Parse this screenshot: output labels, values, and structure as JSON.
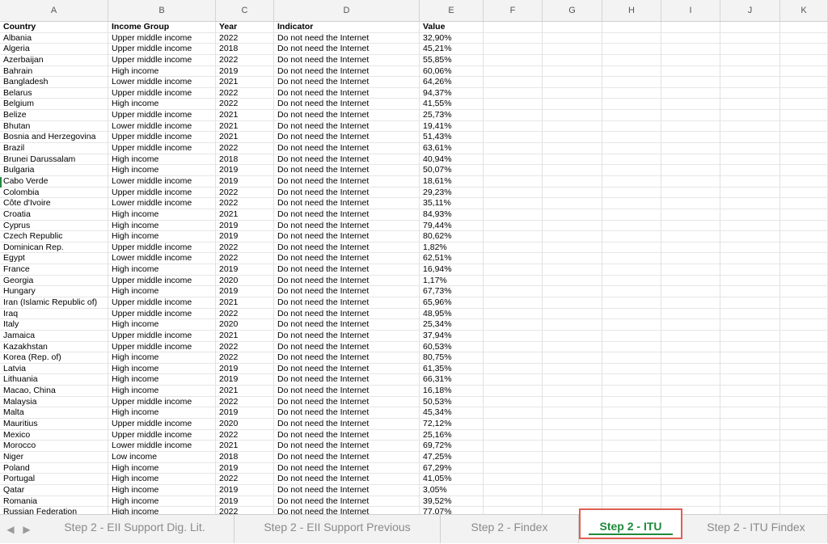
{
  "columns": [
    "A",
    "B",
    "C",
    "D",
    "E",
    "F",
    "G",
    "H",
    "I",
    "J",
    "K"
  ],
  "header": [
    "Country",
    "Income Group",
    "Year",
    "Indicator",
    "Value"
  ],
  "rows": [
    [
      "Albania",
      "Upper middle income",
      "2022",
      "Do not need the Internet",
      "32,90%"
    ],
    [
      "Algeria",
      "Upper middle income",
      "2018",
      "Do not need the Internet",
      "45,21%"
    ],
    [
      "Azerbaijan",
      "Upper middle income",
      "2022",
      "Do not need the Internet",
      "55,85%"
    ],
    [
      "Bahrain",
      "High income",
      "2019",
      "Do not need the Internet",
      "60,06%"
    ],
    [
      "Bangladesh",
      "Lower middle income",
      "2021",
      "Do not need the Internet",
      "64,26%"
    ],
    [
      "Belarus",
      "Upper middle income",
      "2022",
      "Do not need the Internet",
      "94,37%"
    ],
    [
      "Belgium",
      "High income",
      "2022",
      "Do not need the Internet",
      "41,55%"
    ],
    [
      "Belize",
      "Upper middle income",
      "2021",
      "Do not need the Internet",
      "25,73%"
    ],
    [
      "Bhutan",
      "Lower middle income",
      "2021",
      "Do not need the Internet",
      "19,41%"
    ],
    [
      "Bosnia and Herzegovina",
      "Upper middle income",
      "2021",
      "Do not need the Internet",
      "51,43%"
    ],
    [
      "Brazil",
      "Upper middle income",
      "2022",
      "Do not need the Internet",
      "63,61%"
    ],
    [
      "Brunei Darussalam",
      "High income",
      "2018",
      "Do not need the Internet",
      "40,94%"
    ],
    [
      "Bulgaria",
      "High income",
      "2019",
      "Do not need the Internet",
      "50,07%"
    ],
    [
      "Cabo Verde",
      "Lower middle income",
      "2019",
      "Do not need the Internet",
      "18,61%"
    ],
    [
      "Colombia",
      "Upper middle income",
      "2022",
      "Do not need the Internet",
      "29,23%"
    ],
    [
      "Côte d'Ivoire",
      "Lower middle income",
      "2022",
      "Do not need the Internet",
      "35,11%"
    ],
    [
      "Croatia",
      "High income",
      "2021",
      "Do not need the Internet",
      "84,93%"
    ],
    [
      "Cyprus",
      "High income",
      "2019",
      "Do not need the Internet",
      "79,44%"
    ],
    [
      "Czech Republic",
      "High income",
      "2019",
      "Do not need the Internet",
      "80,62%"
    ],
    [
      "Dominican Rep.",
      "Upper middle income",
      "2022",
      "Do not need the Internet",
      "1,82%"
    ],
    [
      "Egypt",
      "Lower middle income",
      "2022",
      "Do not need the Internet",
      "62,51%"
    ],
    [
      "France",
      "High income",
      "2019",
      "Do not need the Internet",
      "16,94%"
    ],
    [
      "Georgia",
      "Upper middle income",
      "2020",
      "Do not need the Internet",
      "1,17%"
    ],
    [
      "Hungary",
      "High income",
      "2019",
      "Do not need the Internet",
      "67,73%"
    ],
    [
      "Iran (Islamic Republic of)",
      "Upper middle income",
      "2021",
      "Do not need the Internet",
      "65,96%"
    ],
    [
      "Iraq",
      "Upper middle income",
      "2022",
      "Do not need the Internet",
      "48,95%"
    ],
    [
      "Italy",
      "High income",
      "2020",
      "Do not need the Internet",
      "25,34%"
    ],
    [
      "Jamaica",
      "Upper middle income",
      "2021",
      "Do not need the Internet",
      "37,94%"
    ],
    [
      "Kazakhstan",
      "Upper middle income",
      "2022",
      "Do not need the Internet",
      "60,53%"
    ],
    [
      "Korea (Rep. of)",
      "High income",
      "2022",
      "Do not need the Internet",
      "80,75%"
    ],
    [
      "Latvia",
      "High income",
      "2019",
      "Do not need the Internet",
      "61,35%"
    ],
    [
      "Lithuania",
      "High income",
      "2019",
      "Do not need the Internet",
      "66,31%"
    ],
    [
      "Macao, China",
      "High income",
      "2021",
      "Do not need the Internet",
      "16,18%"
    ],
    [
      "Malaysia",
      "Upper middle income",
      "2022",
      "Do not need the Internet",
      "50,53%"
    ],
    [
      "Malta",
      "High income",
      "2019",
      "Do not need the Internet",
      "45,34%"
    ],
    [
      "Mauritius",
      "Upper middle income",
      "2020",
      "Do not need the Internet",
      "72,12%"
    ],
    [
      "Mexico",
      "Upper middle income",
      "2022",
      "Do not need the Internet",
      "25,16%"
    ],
    [
      "Morocco",
      "Lower middle income",
      "2021",
      "Do not need the Internet",
      "69,72%"
    ],
    [
      "Niger",
      "Low income",
      "2018",
      "Do not need the Internet",
      "47,25%"
    ],
    [
      "Poland",
      "High income",
      "2019",
      "Do not need the Internet",
      "67,29%"
    ],
    [
      "Portugal",
      "High income",
      "2022",
      "Do not need the Internet",
      "41,05%"
    ],
    [
      "Qatar",
      "High income",
      "2019",
      "Do not need the Internet",
      "3,05%"
    ],
    [
      "Romania",
      "High income",
      "2019",
      "Do not need the Internet",
      "39,52%"
    ],
    [
      "Russian Federation",
      "High income",
      "2022",
      "Do not need the Internet",
      "77,07%"
    ]
  ],
  "tabs": [
    {
      "label": "Step 2 - EII Support Dig. Lit.",
      "active": false
    },
    {
      "label": "Step 2 - EII Support Previous",
      "active": false
    },
    {
      "label": "Step 2 - Findex",
      "active": false
    },
    {
      "label": "Step 2 - ITU",
      "active": true
    },
    {
      "label": "Step 2 - ITU Findex",
      "active": false
    }
  ],
  "icons": {
    "prev": "chevron-left-icon",
    "next": "chevron-right-icon"
  },
  "colors": {
    "active_tab_text": "#1e8a3c",
    "active_tab_border": "#e06050"
  }
}
